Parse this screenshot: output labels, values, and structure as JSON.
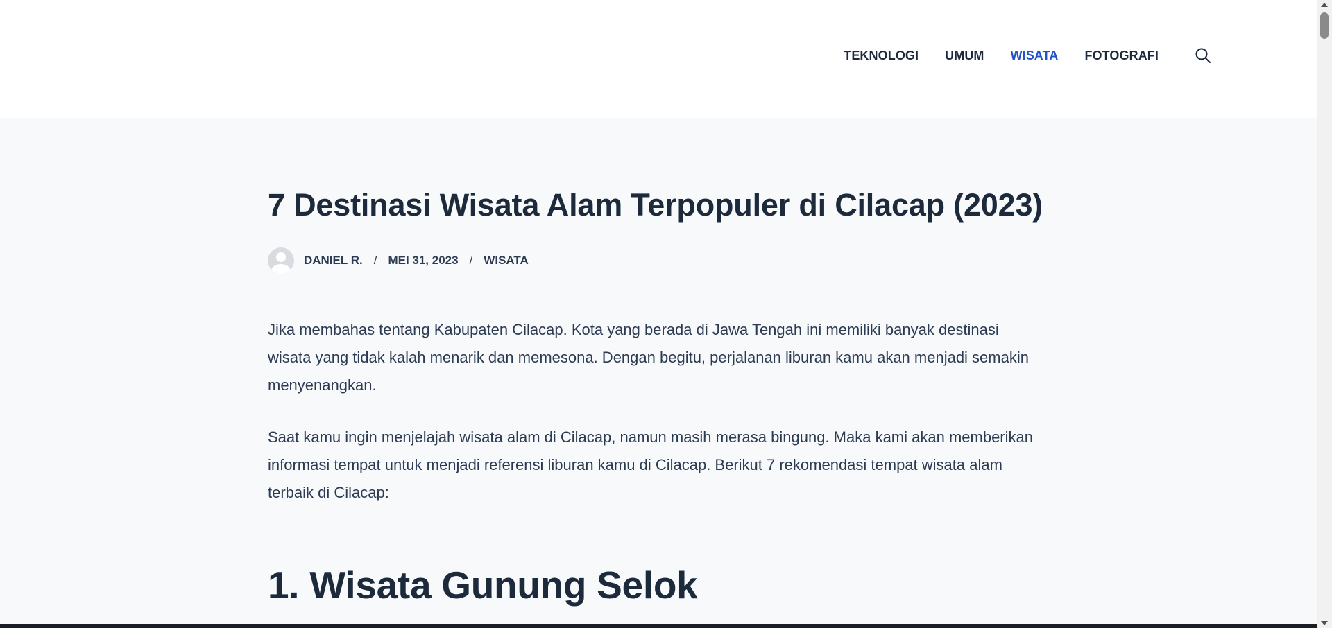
{
  "nav": {
    "items": [
      {
        "label": "TEKNOLOGI",
        "active": false
      },
      {
        "label": "UMUM",
        "active": false
      },
      {
        "label": "WISATA",
        "active": true
      },
      {
        "label": "FOTOGRAFI",
        "active": false
      }
    ],
    "search_icon": "search-icon"
  },
  "post": {
    "title": "7 Destinasi Wisata Alam Terpopuler di Cilacap (2023)",
    "meta": {
      "author": "DANIEL R.",
      "separator": "/",
      "date": "MEI 31, 2023",
      "category": "WISATA"
    },
    "paragraphs": [
      "Jika membahas tentang Kabupaten Cilacap. Kota yang berada di Jawa Tengah ini memiliki banyak destinasi wisata yang tidak kalah menarik dan memesona. Dengan begitu, perjalanan liburan kamu akan menjadi semakin menyenangkan.",
      "Saat kamu ingin menjelajah wisata alam di Cilacap, namun masih merasa bingung. Maka kami akan memberikan informasi tempat untuk menjadi referensi liburan kamu di Cilacap. Berikut 7 rekomendasi tempat wisata alam terbaik di Cilacap:"
    ],
    "section_heading": "1. Wisata Gunung Selok"
  },
  "colors": {
    "accent": "#2251cc",
    "text": "#1c2a3c",
    "background": "#f8f9fb"
  }
}
